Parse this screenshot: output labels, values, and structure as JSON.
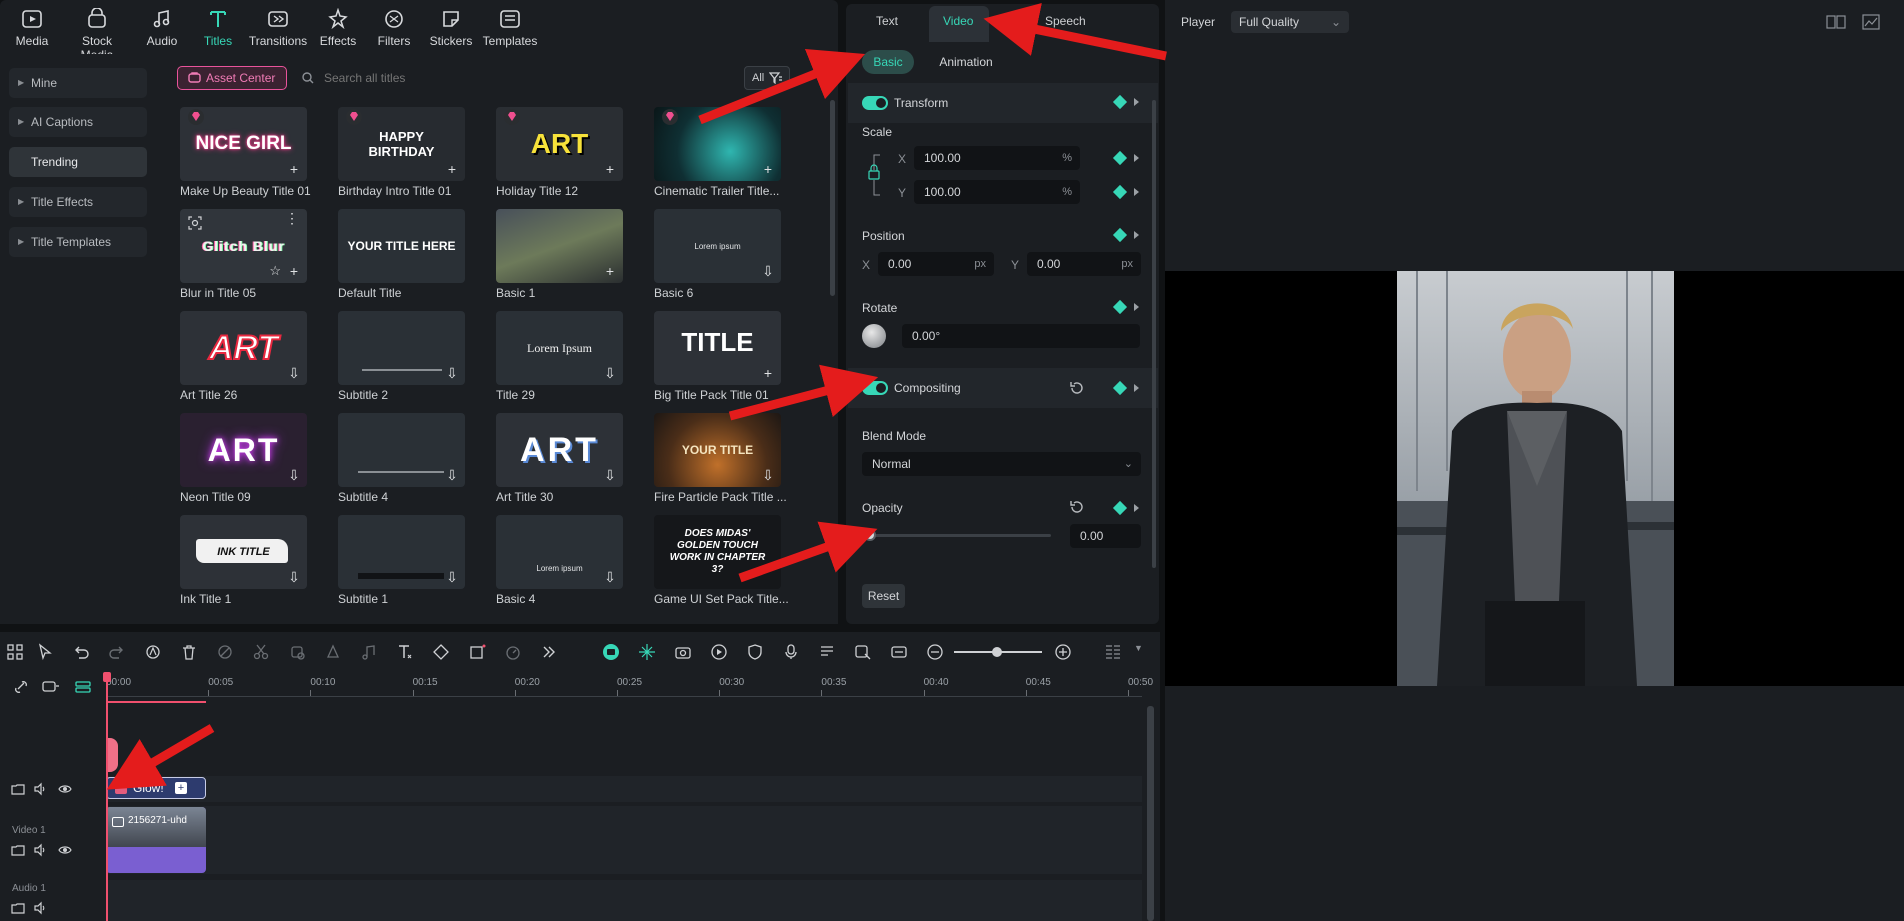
{
  "toolbar": {
    "items": [
      {
        "label": "Media",
        "icon": "media-icon"
      },
      {
        "label": "Stock Media",
        "icon": "stock-media-icon"
      },
      {
        "label": "Audio",
        "icon": "audio-icon"
      },
      {
        "label": "Titles",
        "icon": "titles-icon"
      },
      {
        "label": "Transitions",
        "icon": "transitions-icon"
      },
      {
        "label": "Effects",
        "icon": "effects-icon"
      },
      {
        "label": "Filters",
        "icon": "filters-icon"
      },
      {
        "label": "Stickers",
        "icon": "stickers-icon"
      },
      {
        "label": "Templates",
        "icon": "templates-icon"
      }
    ],
    "active": "Titles",
    "accent_color": "#37d7b7"
  },
  "sidebar": {
    "items": [
      "Mine",
      "AI Captions",
      "Trending",
      "Title Effects",
      "Title Templates"
    ],
    "active": "Trending"
  },
  "browser": {
    "asset_center": "Asset Center",
    "search_placeholder": "Search all titles",
    "filter": "All",
    "cards": [
      {
        "label": "Make Up Beauty Title 01",
        "preview": "NICE GIRL"
      },
      {
        "label": "Birthday Intro Title 01",
        "preview": "HAPPY BIRTHDAY"
      },
      {
        "label": "Holiday Title 12",
        "preview": "ART"
      },
      {
        "label": "Cinematic Trailer Title...",
        "preview": ""
      },
      {
        "label": "Blur in Title 05",
        "preview": "Glitch Blur"
      },
      {
        "label": "Default Title",
        "preview": "YOUR TITLE HERE"
      },
      {
        "label": "Basic 1",
        "preview": ""
      },
      {
        "label": "Basic 6",
        "preview": "Lorem ipsum"
      },
      {
        "label": "Art Title 26",
        "preview": "ART"
      },
      {
        "label": "Subtitle 2",
        "preview": ""
      },
      {
        "label": "Title 29",
        "preview": "Lorem Ipsum"
      },
      {
        "label": "Big Title Pack Title 01",
        "preview": "TITLE"
      },
      {
        "label": "Neon Title 09",
        "preview": "ART"
      },
      {
        "label": "Subtitle 4",
        "preview": ""
      },
      {
        "label": "Art Title 30",
        "preview": "ART"
      },
      {
        "label": "Fire Particle Pack Title ...",
        "preview": "YOUR TITLE"
      },
      {
        "label": "Ink Title 1",
        "preview": "INK TITLE"
      },
      {
        "label": "Subtitle 1",
        "preview": ""
      },
      {
        "label": "Basic 4",
        "preview": "Lorem ipsum"
      },
      {
        "label": "Game UI Set Pack Title...",
        "preview": "DOES MIDAS' GOLDEN TOUCH WORK IN CHAPTER 3?"
      }
    ]
  },
  "properties": {
    "tabs": [
      "Text",
      "Video",
      "Speech"
    ],
    "active_tab": "Video",
    "subtabs": [
      "Basic",
      "Animation"
    ],
    "active_subtab": "Basic",
    "transform": {
      "title": "Transform",
      "scale_label": "Scale",
      "scale_x": "100.00",
      "scale_y": "100.00",
      "scale_unit": "%",
      "position_label": "Position",
      "pos_x": "0.00",
      "pos_y": "0.00",
      "pos_unit": "px",
      "rotate_label": "Rotate",
      "rotate": "0.00°",
      "x_label": "X",
      "y_label": "Y"
    },
    "compositing": {
      "title": "Compositing",
      "blend_label": "Blend Mode",
      "blend": "Normal",
      "opacity_label": "Opacity",
      "opacity": "0.00"
    },
    "reset": "Reset"
  },
  "player": {
    "label": "Player",
    "quality": "Full Quality"
  },
  "timeline": {
    "ticks": [
      "00:00",
      "00:05",
      "00:10",
      "00:15",
      "00:20",
      "00:25",
      "00:30",
      "00:35",
      "00:40",
      "00:45",
      "00:50"
    ],
    "tracks": {
      "video": "Video 1",
      "audio": "Audio 1"
    },
    "title_clip": "Glow!",
    "video_clip_text": "2156271-uhd"
  }
}
